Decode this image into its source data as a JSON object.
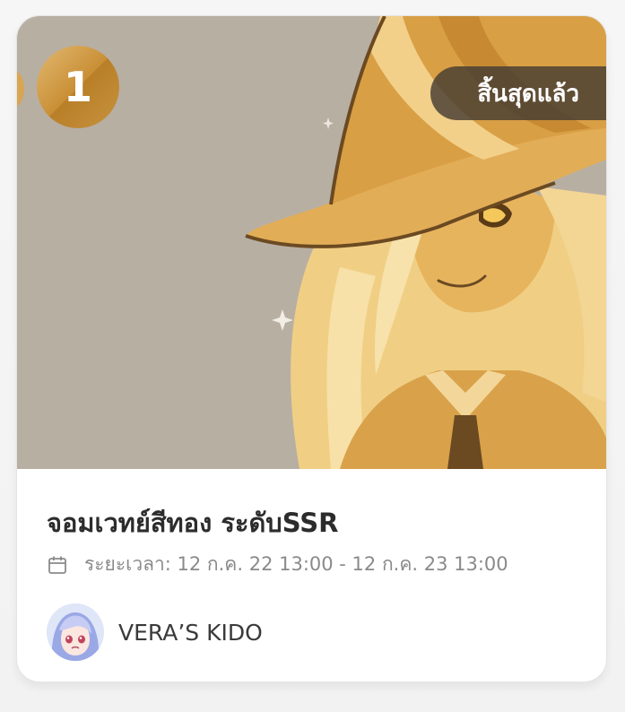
{
  "card": {
    "rank": "1",
    "status": "สิ้นสุดแล้ว",
    "title": "จอมเวทย์สีทอง ระดับSSR",
    "period_text": "ระยะเวลา: 12 ก.ค. 22 13:00 - 12 ก.ค. 23 13:00",
    "author_name": "VERA’S KIDO"
  },
  "icons": {
    "calendar": "calendar-icon",
    "avatar": "author-avatar"
  },
  "colors": {
    "hero_background": "#b8afa3",
    "gold": "#d9a24a",
    "status_pill": "#463c32",
    "title": "#2c2c2c",
    "meta_text": "#8a8a8a"
  }
}
